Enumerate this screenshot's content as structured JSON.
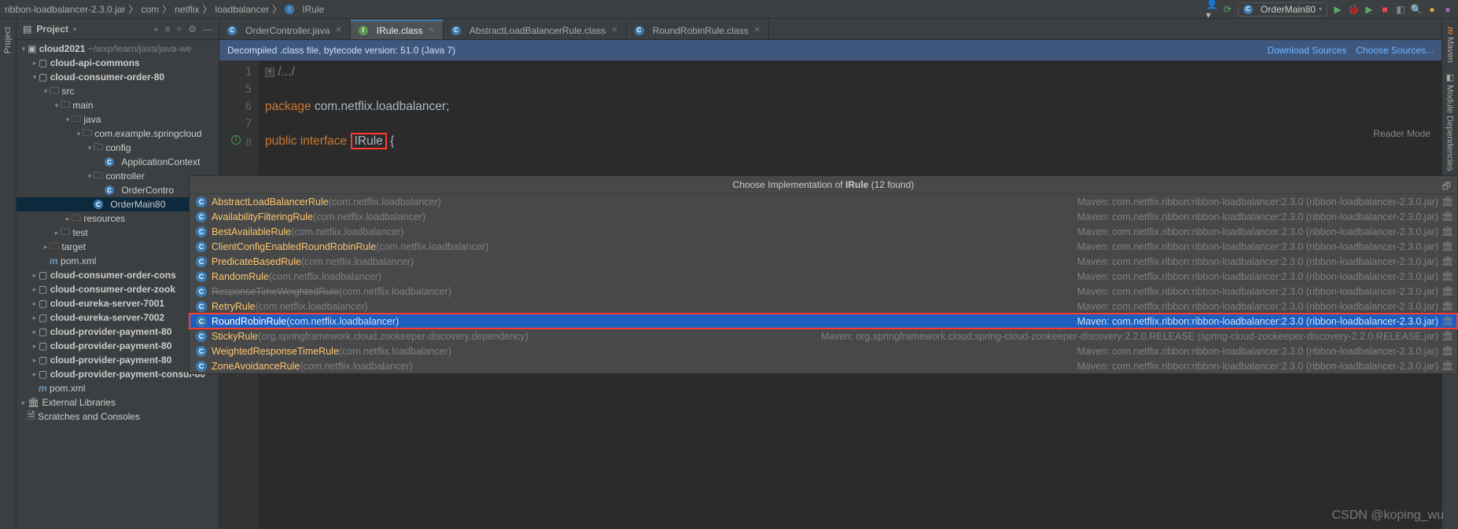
{
  "breadcrumb": {
    "seg0": "ribbon-loadbalancer-2.3.0.jar",
    "seg1": "com",
    "seg2": "netflix",
    "seg3": "loadbalancer",
    "seg4": "IRule"
  },
  "run_config": {
    "label": "OrderMain80"
  },
  "side_tabs": {
    "left": "Project",
    "right_maven": "Maven",
    "right_deps": "Module Dependencies"
  },
  "panel": {
    "title": "Project"
  },
  "tree": {
    "cloud2021": "cloud2021",
    "cloud2021_path": "~/wxp/learn/java/java-we",
    "api_commons": "cloud-api-commons",
    "consumer80": "cloud-consumer-order-80",
    "src": "src",
    "main": "main",
    "java": "java",
    "pkg": "com.example.springcloud",
    "config": "config",
    "appctx": "ApplicationContext",
    "controller": "controller",
    "orderctrl": "OrderContro",
    "ordermain": "OrderMain80",
    "resources": "resources",
    "test": "test",
    "target": "target",
    "pom": "pom.xml",
    "cons_cons": "cloud-consumer-order-cons",
    "cons_zook": "cloud-consumer-order-zook",
    "eureka1": "cloud-eureka-server-7001",
    "eureka2": "cloud-eureka-server-7002",
    "pay1": "cloud-provider-payment-80",
    "pay2": "cloud-provider-payment-80",
    "pay3": "cloud-provider-payment-80",
    "pay_consul": "cloud-provider-payment-consul-80",
    "extlib": "External Libraries",
    "scratch": "Scratches and Consoles"
  },
  "tabs": {
    "t0": "OrderController.java",
    "t1": "IRule.class",
    "t2": "AbstractLoadBalancerRule.class",
    "t3": "RoundRobinRule.class"
  },
  "banner": {
    "msg": "Decompiled .class file, bytecode version: 51.0 (Java 7)",
    "link1": "Download Sources",
    "link2": "Choose Sources..."
  },
  "reader": {
    "label": "Reader Mode"
  },
  "code": {
    "fold": "/.../",
    "pkg_kw": "package ",
    "pkg_name": "com.netflix.loadbalancer",
    "semi": ";",
    "public": "public ",
    "interface": "interface ",
    "iface": "IRule",
    "brace": " {"
  },
  "gutter": {
    "l1": "1",
    "l5": "5",
    "l6": "6",
    "l7": "7",
    "l8": "8",
    "impl_icon": "I↓"
  },
  "popup": {
    "title_prefix": "Choose Implementation of ",
    "title_name": "IRule",
    "title_suffix": " (12 found)",
    "rows": [
      {
        "name": "AbstractLoadBalancerRule",
        "pkg": "(com.netflix.loadbalancer)",
        "right": "Maven: com.netflix.ribbon:ribbon-loadbalancer:2.3.0 (ribbon-loadbalancer-2.3.0.jar)",
        "strike": false,
        "sel": false
      },
      {
        "name": "AvailabilityFilteringRule",
        "pkg": "(com.netflix.loadbalancer)",
        "right": "Maven: com.netflix.ribbon:ribbon-loadbalancer:2.3.0 (ribbon-loadbalancer-2.3.0.jar)",
        "strike": false,
        "sel": false
      },
      {
        "name": "BestAvailableRule",
        "pkg": "(com.netflix.loadbalancer)",
        "right": "Maven: com.netflix.ribbon:ribbon-loadbalancer:2.3.0 (ribbon-loadbalancer-2.3.0.jar)",
        "strike": false,
        "sel": false
      },
      {
        "name": "ClientConfigEnabledRoundRobinRule",
        "pkg": "(com.netflix.loadbalancer)",
        "right": "Maven: com.netflix.ribbon:ribbon-loadbalancer:2.3.0 (ribbon-loadbalancer-2.3.0.jar)",
        "strike": false,
        "sel": false
      },
      {
        "name": "PredicateBasedRule",
        "pkg": "(com.netflix.loadbalancer)",
        "right": "Maven: com.netflix.ribbon:ribbon-loadbalancer:2.3.0 (ribbon-loadbalancer-2.3.0.jar)",
        "strike": false,
        "sel": false
      },
      {
        "name": "RandomRule",
        "pkg": "(com.netflix.loadbalancer)",
        "right": "Maven: com.netflix.ribbon:ribbon-loadbalancer:2.3.0 (ribbon-loadbalancer-2.3.0.jar)",
        "strike": false,
        "sel": false
      },
      {
        "name": "ResponseTimeWeightedRule",
        "pkg": "(com.netflix.loadbalancer)",
        "right": "Maven: com.netflix.ribbon:ribbon-loadbalancer:2.3.0 (ribbon-loadbalancer-2.3.0.jar)",
        "strike": true,
        "sel": false
      },
      {
        "name": "RetryRule",
        "pkg": "(com.netflix.loadbalancer)",
        "right": "Maven: com.netflix.ribbon:ribbon-loadbalancer:2.3.0 (ribbon-loadbalancer-2.3.0.jar)",
        "strike": false,
        "sel": false
      },
      {
        "name": "RoundRobinRule",
        "pkg": "(com.netflix.loadbalancer)",
        "right": "Maven: com.netflix.ribbon:ribbon-loadbalancer:2.3.0 (ribbon-loadbalancer-2.3.0.jar)",
        "strike": false,
        "sel": true
      },
      {
        "name": "StickyRule",
        "pkg": "(org.springframework.cloud.zookeeper.discovery.dependency)",
        "right": "Maven: org.springframework.cloud:spring-cloud-zookeeper-discovery:2.2.0.RELEASE (spring-cloud-zookeeper-discovery-2.2.0.RELEASE.jar)",
        "strike": false,
        "sel": false
      },
      {
        "name": "WeightedResponseTimeRule",
        "pkg": "(com.netflix.loadbalancer)",
        "right": "Maven: com.netflix.ribbon:ribbon-loadbalancer:2.3.0 (ribbon-loadbalancer-2.3.0.jar)",
        "strike": false,
        "sel": false
      },
      {
        "name": "ZoneAvoidanceRule",
        "pkg": "(com.netflix.loadbalancer)",
        "right": "Maven: com.netflix.ribbon:ribbon-loadbalancer:2.3.0 (ribbon-loadbalancer-2.3.0.jar)",
        "strike": false,
        "sel": false
      }
    ]
  },
  "watermark": {
    "text": "CSDN @koping_wu"
  }
}
